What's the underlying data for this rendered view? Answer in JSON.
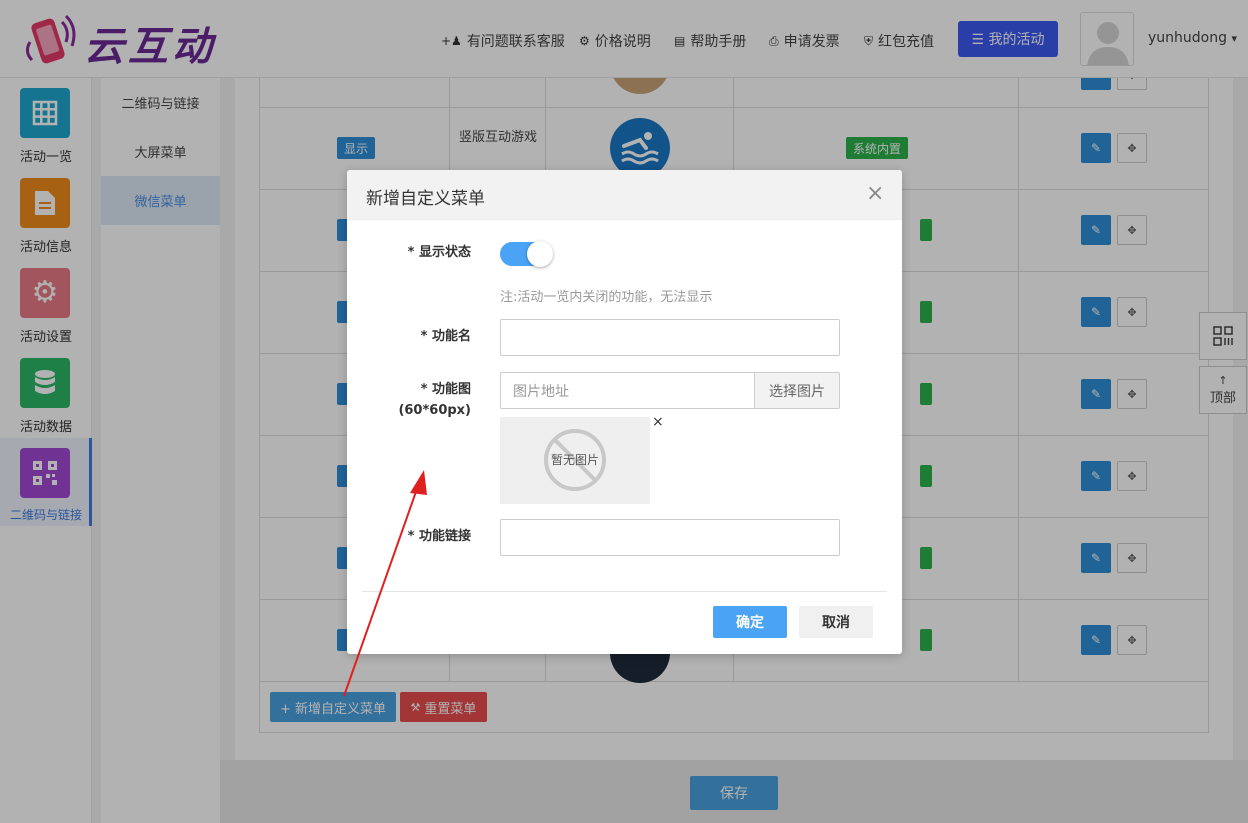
{
  "header": {
    "brand": "云互动",
    "nav": [
      {
        "icon": "add-user-icon",
        "label": "有问题联系客服"
      },
      {
        "icon": "gear-icon",
        "label": "价格说明"
      },
      {
        "icon": "book-icon",
        "label": "帮助手册"
      },
      {
        "icon": "printer-icon",
        "label": "申请发票"
      },
      {
        "icon": "shield-icon",
        "label": "红包充值"
      }
    ],
    "my_activity": "☰ 我的活动",
    "username": "yunhudong",
    "username_caret": "▾"
  },
  "sidebar": {
    "items": [
      {
        "label": "活动一览",
        "color": "#1fa6cf",
        "icon": "grid-icon"
      },
      {
        "label": "活动信息",
        "color": "#f08c1c",
        "icon": "document-icon"
      },
      {
        "label": "活动设置",
        "color": "#e97a86",
        "icon": "gear-icon"
      },
      {
        "label": "活动数据",
        "color": "#2bb865",
        "icon": "database-icon"
      },
      {
        "label": "二维码与链接",
        "color": "#a14ad4",
        "icon": "qrcode-icon"
      }
    ]
  },
  "submenu": {
    "items": [
      {
        "label": "二维码与链接"
      },
      {
        "label": "大屏菜单"
      },
      {
        "label": "微信菜单"
      }
    ]
  },
  "table": {
    "row_status": "显示",
    "row_name": "竖版互动游戏",
    "row_type": "系统内置",
    "edit_glyph": "✎",
    "move_glyph": "✥"
  },
  "actions": {
    "add_custom": "+ 新增自定义菜单",
    "reset": "重置菜单",
    "save": "保存"
  },
  "float": {
    "qr": "",
    "top": "顶部",
    "top_arrow": "↑"
  },
  "modal": {
    "title": "新增自定义菜单",
    "close": "×",
    "status_label": "* 显示状态",
    "status_on": true,
    "status_hint": "注:活动一览内关闭的功能，无法显示",
    "name_label": "* 功能名",
    "name_value": "",
    "image_label_1": "* 功能图",
    "image_label_2": "(60*60px)",
    "image_placeholder": "图片地址",
    "pick_image": "选择图片",
    "no_image": "暂无图片",
    "remove_image": "×",
    "link_label": "* 功能链接",
    "link_value": "",
    "ok": "确定",
    "cancel": "取消"
  }
}
